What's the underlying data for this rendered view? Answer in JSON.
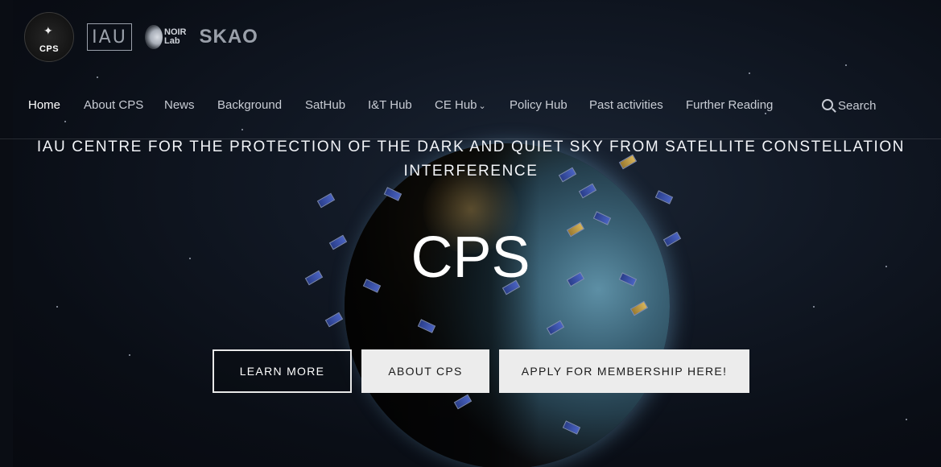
{
  "header": {
    "logos": {
      "cps": "CPS",
      "iau": "IAU",
      "noir": [
        "NOIR",
        "Lab"
      ],
      "skao": "SKAO"
    }
  },
  "nav": {
    "items": [
      {
        "label": "Home",
        "active": true
      },
      {
        "label": "About CPS"
      },
      {
        "label": "News"
      },
      {
        "label": "Background"
      },
      {
        "label": "SatHub"
      },
      {
        "label": "I&T Hub"
      },
      {
        "label": "CE Hub",
        "has_dropdown": true
      },
      {
        "label": "Policy Hub"
      },
      {
        "label": "Past activities"
      },
      {
        "label": "Further Reading"
      }
    ],
    "search_label": "Search"
  },
  "hero": {
    "title_line1": "IAU CENTRE FOR THE PROTECTION OF THE DARK AND QUIET SKY FROM SATELLITE CONSTELLATION",
    "title_line2": "INTERFERENCE",
    "big_text": "CPS",
    "buttons": {
      "learn_more": "LEARN MORE",
      "about": "ABOUT CPS",
      "apply": "APPLY FOR MEMBERSHIP HERE!"
    }
  }
}
